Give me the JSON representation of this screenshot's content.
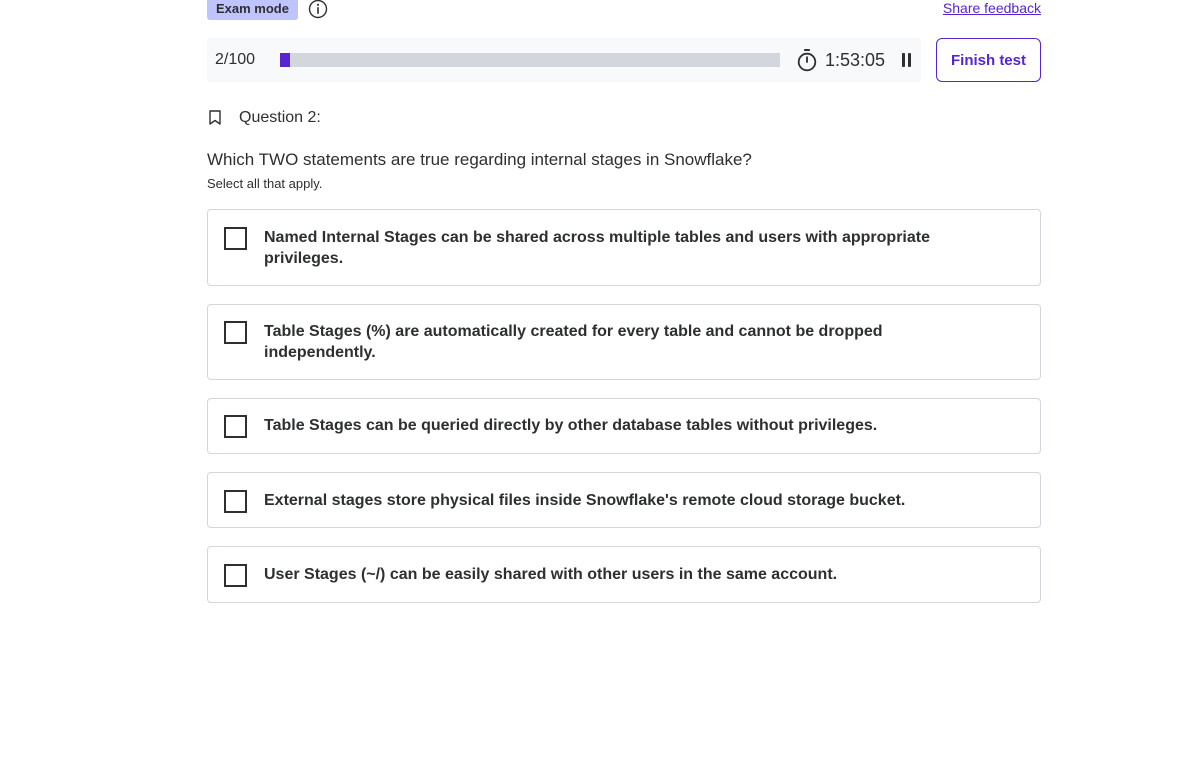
{
  "header": {
    "badge_label": "Exam mode",
    "info_icon": "info-icon",
    "share_feedback": "Share feedback"
  },
  "progress": {
    "count_text": "2/100",
    "fraction": 0.02,
    "timer": "1:53:05",
    "timer_icon": "stopwatch-icon",
    "pause_icon": "pause-icon"
  },
  "finish_button": "Finish test",
  "question": {
    "bookmark_icon": "bookmark-icon",
    "title": "Question 2:",
    "text": "Which TWO statements are true regarding internal stages in Snowflake?",
    "hint": "Select all that apply."
  },
  "options": [
    {
      "label": "Named Internal Stages can be shared across multiple tables and users with appropriate privileges.",
      "checked": false
    },
    {
      "label": "Table Stages (%) are automatically created for every table and cannot be dropped independently.",
      "checked": false
    },
    {
      "label": "Table Stages can be queried directly by other database tables without privileges.",
      "checked": false
    },
    {
      "label": "External stages store physical files inside Snowflake's remote cloud storage bucket.",
      "checked": false
    },
    {
      "label": "User Stages (~/) can be easily shared with other users in the same account.",
      "checked": false
    }
  ],
  "colors": {
    "accent": "#5624d0",
    "badge_bg": "#c0c4fc",
    "track": "#d1d7dc",
    "panel_bg": "#f7f9fa",
    "text": "#2d2f31"
  }
}
